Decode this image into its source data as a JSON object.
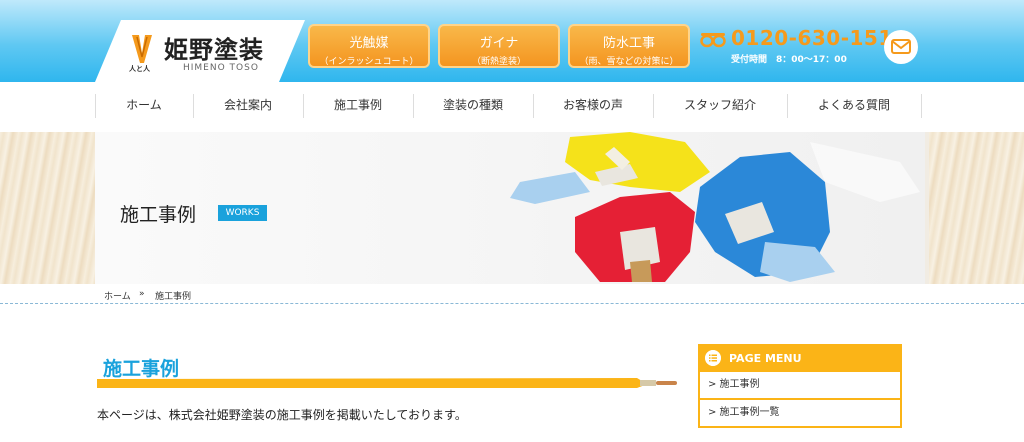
{
  "header": {
    "logo_mark_text": "人と人",
    "logo_name": "姫野塗装",
    "logo_roman": "HIMENO TOSO",
    "buttons": [
      {
        "title": "光触媒",
        "sub": "（インラッシュコート）"
      },
      {
        "title": "ガイナ",
        "sub": "（断熱塗装）"
      },
      {
        "title": "防水工事",
        "sub": "（雨、雪などの対策に）"
      }
    ],
    "tel": "0120-630-151",
    "hours": "受付時間　8：00～17：00",
    "mail_icon": "envelope-icon",
    "colors": {
      "sky": "#2fb6ee",
      "orange": "#f49520",
      "tel": "#f59a1c"
    }
  },
  "nav": {
    "items": [
      "ホーム",
      "会社案内",
      "施工事例",
      "塗装の種類",
      "お客様の声",
      "スタッフ紹介",
      "よくある質問"
    ]
  },
  "hero": {
    "title": "施工事例",
    "badge": "WORKS",
    "badge_color": "#1aa2dc"
  },
  "breadcrumb": {
    "home": "ホーム",
    "sep": "»",
    "current": "施工事例"
  },
  "main": {
    "section_title": "施工事例",
    "intro": "本ページは、株式会社姫野塗装の施工事例を掲載いたしております。"
  },
  "side_menu": {
    "heading": "PAGE MENU",
    "items": [
      "> 施工事例",
      "> 施工事例一覧"
    ],
    "accent": "#fbb417"
  }
}
